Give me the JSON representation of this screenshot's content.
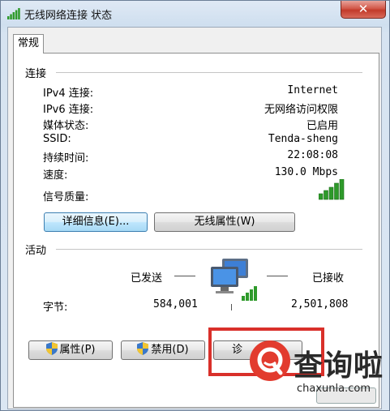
{
  "window": {
    "title": "无线网络连接 状态",
    "close_label": "✕"
  },
  "tabs": [
    {
      "label": "常规"
    }
  ],
  "connection": {
    "heading": "连接",
    "rows": [
      {
        "label": "IPv4 连接:",
        "value": "Internet"
      },
      {
        "label": "IPv6 连接:",
        "value": "无网络访问权限"
      },
      {
        "label": "媒体状态:",
        "value": "已启用"
      },
      {
        "label": "SSID:",
        "value": "Tenda-sheng"
      },
      {
        "label": "持续时间:",
        "value": "22:08:08"
      },
      {
        "label": "速度:",
        "value": "130.0 Mbps"
      }
    ],
    "signal_label": "信号质量:",
    "signal_bars": 5,
    "details_button": "详细信息(E)...",
    "wireless_props_button": "无线属性(W)"
  },
  "activity": {
    "heading": "活动",
    "sent_label": "已发送",
    "received_label": "已接收",
    "bytes_label": "字节:",
    "bytes_sent": "584,001",
    "bytes_received": "2,501,808"
  },
  "buttons": {
    "properties": "属性(P)",
    "disable": "禁用(D)",
    "diagnose": "诊"
  },
  "watermark": {
    "text": "查询啦",
    "url": "chaxunla.com"
  },
  "colors": {
    "signal_green": "#2e9a2a",
    "highlight_red": "#d9302a",
    "focus_blue": "#3c7fb1"
  }
}
